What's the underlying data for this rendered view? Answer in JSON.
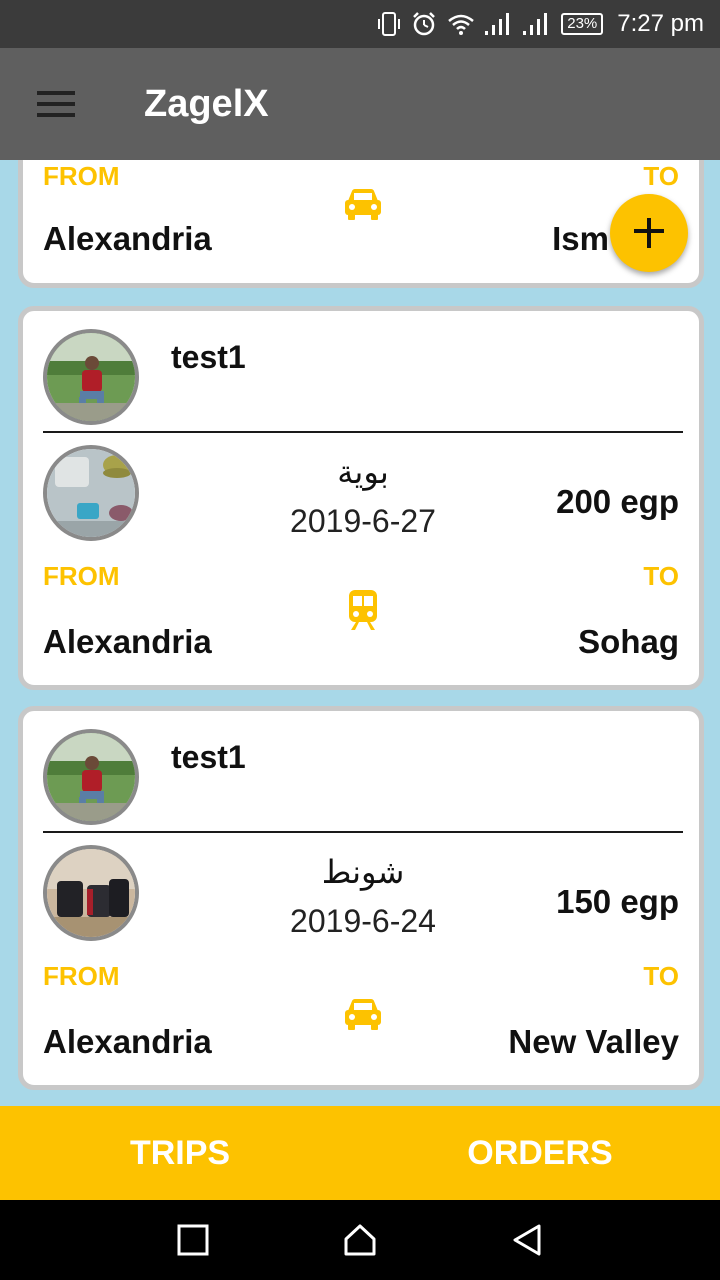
{
  "status_bar": {
    "battery": "23%",
    "time": "7:27 pm",
    "icons": [
      "vibrate-icon",
      "alarm-icon",
      "wifi-icon",
      "signal-icon",
      "signal-icon",
      "battery-icon"
    ]
  },
  "app_bar": {
    "title": "ZagelX",
    "menu_icon": "hamburger-menu-icon"
  },
  "colors": {
    "accent": "#fdc200",
    "app_bar": "#5f5f5f",
    "status_bar": "#3b3b3b",
    "background": "#a8d8e8"
  },
  "cards": [
    {
      "from_label": "FROM",
      "to_label": "TO",
      "from_city": "Alexandria",
      "to_city": "Ism",
      "transport_icon": "car-icon"
    },
    {
      "username": "test1",
      "item_name": "بوية",
      "date": "2019-6-27",
      "price": "200 egp",
      "from_label": "FROM",
      "to_label": "TO",
      "from_city": "Alexandria",
      "to_city": "Sohag",
      "transport_icon": "train-icon"
    },
    {
      "username": "test1",
      "item_name": "شونط",
      "date": "2019-6-24",
      "price": "150 egp",
      "from_label": "FROM",
      "to_label": "TO",
      "from_city": "Alexandria",
      "to_city": "New Valley",
      "transport_icon": "car-icon"
    }
  ],
  "fab": {
    "icon": "add-icon"
  },
  "bottom_tabs": {
    "trips": "TRIPS",
    "orders": "ORDERS"
  },
  "nav_bar": {
    "icons": [
      "recents-square-icon",
      "home-icon",
      "back-icon"
    ]
  }
}
